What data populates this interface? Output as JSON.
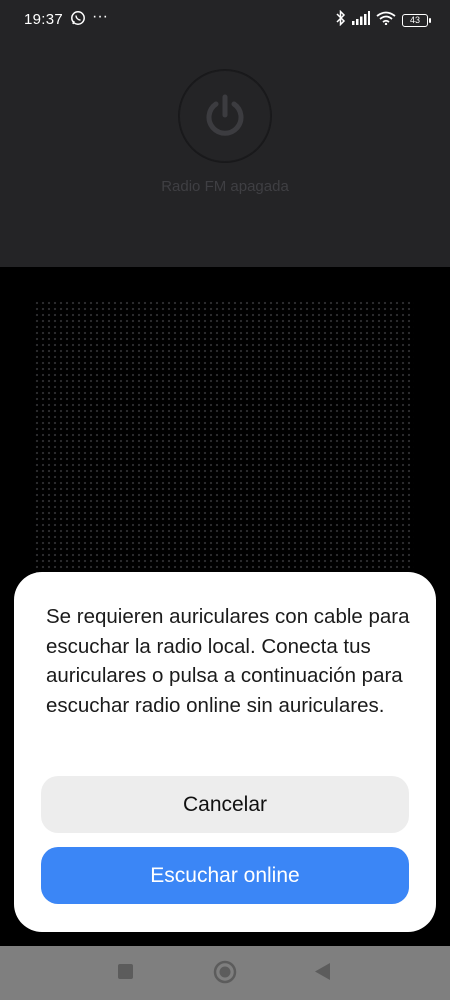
{
  "status_bar": {
    "time": "19:37",
    "notification_icons": [
      "whatsapp-icon",
      "more-dots-icon"
    ],
    "system_icons": [
      "bluetooth-icon",
      "signal-icon",
      "wifi-icon",
      "battery-icon"
    ],
    "battery_level": "43"
  },
  "radio": {
    "power_icon": "power-icon",
    "status_text": "Radio FM apagada"
  },
  "dialog": {
    "message": "Se requieren auriculares con cable para escuchar la radio local. Conecta tus auriculares o pulsa a continuación para escuchar radio online sin auriculares.",
    "cancel_label": "Cancelar",
    "online_label": "Escuchar online"
  },
  "nav": {
    "icons": [
      "recents-square-icon",
      "home-circle-icon",
      "back-triangle-icon"
    ]
  },
  "colors": {
    "accent": "#3b86f6",
    "header_bg": "#242426",
    "dialog_bg": "#ffffff"
  }
}
